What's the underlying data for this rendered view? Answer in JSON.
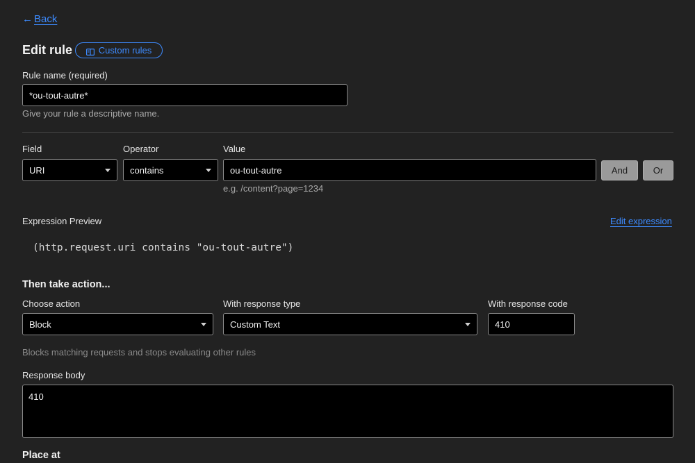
{
  "nav": {
    "back_label": "Back"
  },
  "header": {
    "title": "Edit rule",
    "docs_label": "Custom rules"
  },
  "rule_name": {
    "label": "Rule name (required)",
    "value": "*ou-tout-autre*",
    "help": "Give your rule a descriptive name."
  },
  "condition": {
    "field_label": "Field",
    "field_value": "URI",
    "operator_label": "Operator",
    "operator_value": "contains",
    "value_label": "Value",
    "value_value": "ou-tout-autre",
    "value_hint": "e.g. /content?page=1234",
    "and_label": "And",
    "or_label": "Or"
  },
  "expression": {
    "label": "Expression Preview",
    "edit_label": "Edit expression",
    "code": "(http.request.uri contains \"ou-tout-autre\")"
  },
  "action": {
    "heading": "Then take action...",
    "choose_label": "Choose action",
    "choose_value": "Block",
    "response_type_label": "With response type",
    "response_type_value": "Custom Text",
    "response_code_label": "With response code",
    "response_code_value": "410",
    "description": "Blocks matching requests and stops evaluating other rules"
  },
  "response_body": {
    "label": "Response body",
    "value": "410"
  },
  "placement": {
    "heading": "Place at"
  },
  "colors": {
    "accent": "#3d8bff",
    "background": "#222222",
    "input_bg": "#000000"
  }
}
